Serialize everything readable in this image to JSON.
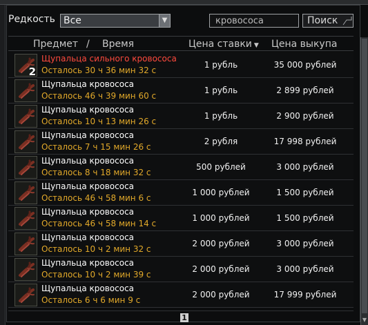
{
  "filters": {
    "rarity_label": "Редкость",
    "rarity_value": "Все",
    "search_value": "кровососа",
    "search_button": "Поиск"
  },
  "columns": {
    "item": "Предмет",
    "separator": "/",
    "time": "Время",
    "bid": "Цена ставки",
    "bid_sort": "▼",
    "buyout": "Цена выкупа"
  },
  "rows": [
    {
      "name": "Щупальца сильного кровососа",
      "rare": true,
      "quantity": "2",
      "time": "Осталось 30 ч 36 мин 32 с",
      "bid": "1 рубль",
      "buyout": "35 000 рублей"
    },
    {
      "name": "Щупальца кровососа",
      "rare": false,
      "quantity": "",
      "time": "Осталось 46 ч 39 мин 60 с",
      "bid": "1 рубль",
      "buyout": "2 899 рублей"
    },
    {
      "name": "Щупальца кровососа",
      "rare": false,
      "quantity": "",
      "time": "Осталось 10 ч 13 мин 26 с",
      "bid": "1 рубль",
      "buyout": "2 900 рублей"
    },
    {
      "name": "Щупальца кровососа",
      "rare": false,
      "quantity": "",
      "time": "Осталось 7 ч 15 мин 26 с",
      "bid": "2 рубля",
      "buyout": "17 998 рублей"
    },
    {
      "name": "Щупальца кровососа",
      "rare": false,
      "quantity": "",
      "time": "Осталось 8 ч 18 мин 32 с",
      "bid": "500 рублей",
      "buyout": "3 000 рублей"
    },
    {
      "name": "Щупальца кровососа",
      "rare": false,
      "quantity": "",
      "time": "Осталось 46 ч 58 мин 6 с",
      "bid": "1 000 рублей",
      "buyout": "1 500 рублей"
    },
    {
      "name": "Щупальца кровососа",
      "rare": false,
      "quantity": "",
      "time": "Осталось 46 ч 58 мин 14 с",
      "bid": "1 000 рублей",
      "buyout": "1 500 рублей"
    },
    {
      "name": "Щупальца кровососа",
      "rare": false,
      "quantity": "",
      "time": "Осталось 10 ч 2 мин 32 с",
      "bid": "2 000 рублей",
      "buyout": "3 000 рублей"
    },
    {
      "name": "Щупальца кровососа",
      "rare": false,
      "quantity": "",
      "time": "Осталось 10 ч 2 мин 39 с",
      "bid": "2 000 рублей",
      "buyout": "3 000 рублей"
    },
    {
      "name": "Щупальца кровососа",
      "rare": false,
      "quantity": "",
      "time": "Осталось 6 ч 6 мин 9 с",
      "bid": "2 000 рублей",
      "buyout": "17 999 рублей"
    }
  ],
  "pagination": {
    "current_page": "1"
  },
  "colors": {
    "rare_name": "#ff4a3d",
    "time_text": "#e2a92a",
    "panel_bg": "#0c0d0e"
  },
  "icons": {
    "item": "tentacle-icon",
    "dropdown": "chevron-down-icon"
  }
}
